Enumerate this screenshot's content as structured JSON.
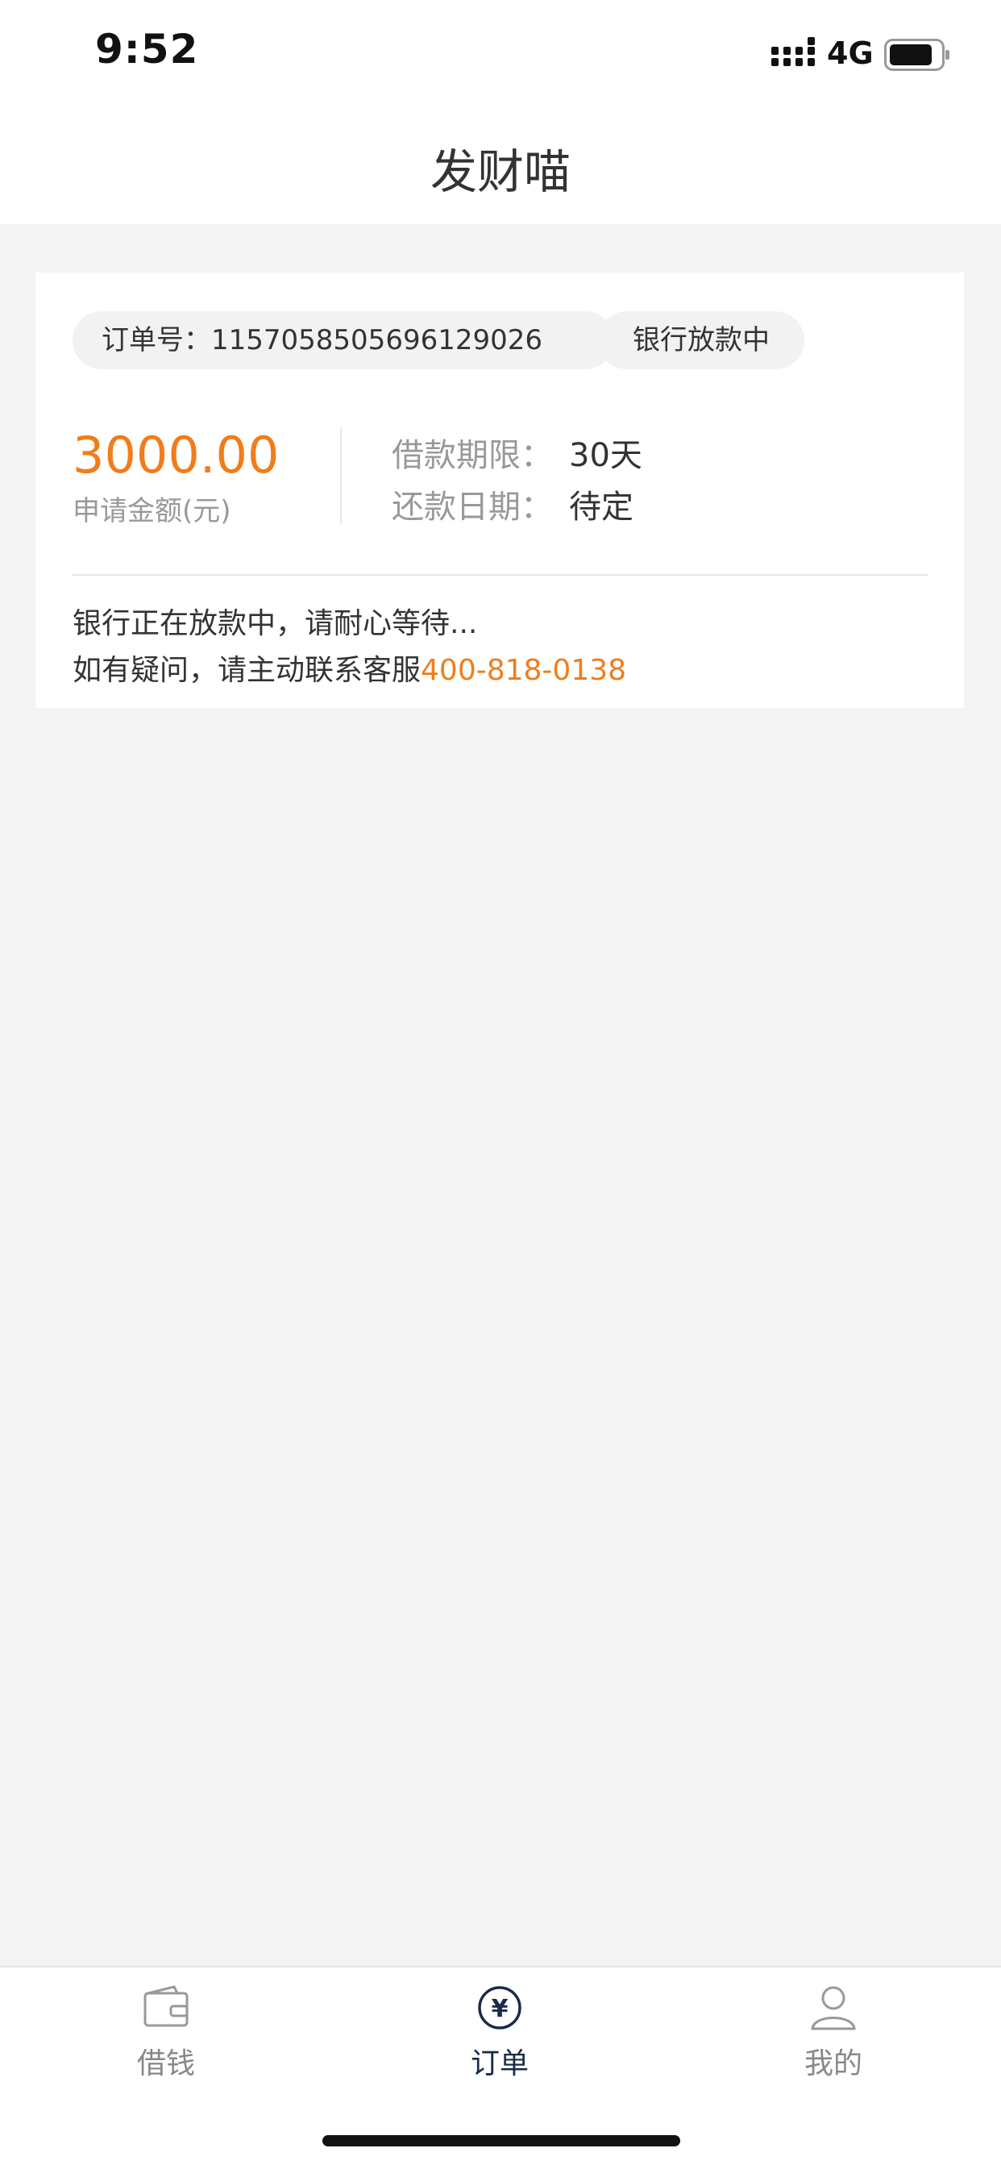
{
  "status_bar": {
    "time": "9:52",
    "network": "4G",
    "icons": [
      "signal-icon",
      "battery-icon"
    ]
  },
  "header": {
    "title": "发财喵"
  },
  "order": {
    "number_text": "订单号：1157058505696129026",
    "status_text": "银行放款中",
    "amount": "3000.00",
    "amount_label": "申请金额(元)",
    "term_label": "借款期限：",
    "term_value": "30天",
    "repay_label": "还款日期：",
    "repay_value": "待定",
    "message_line1": "银行正在放款中，请耐心等待...",
    "message_line2_prefix": "如有疑问，请主动联系客服",
    "phone": "400-818-0138"
  },
  "tabbar": {
    "items": [
      {
        "label": "借钱",
        "icon": "wallet-icon",
        "active": false
      },
      {
        "label": "订单",
        "icon": "yen-icon",
        "active": true
      },
      {
        "label": "我的",
        "icon": "user-icon",
        "active": false
      }
    ]
  },
  "colors": {
    "accent": "#f07d1b",
    "background": "#f4f4f4",
    "active_tab": "#1a2a4a"
  }
}
